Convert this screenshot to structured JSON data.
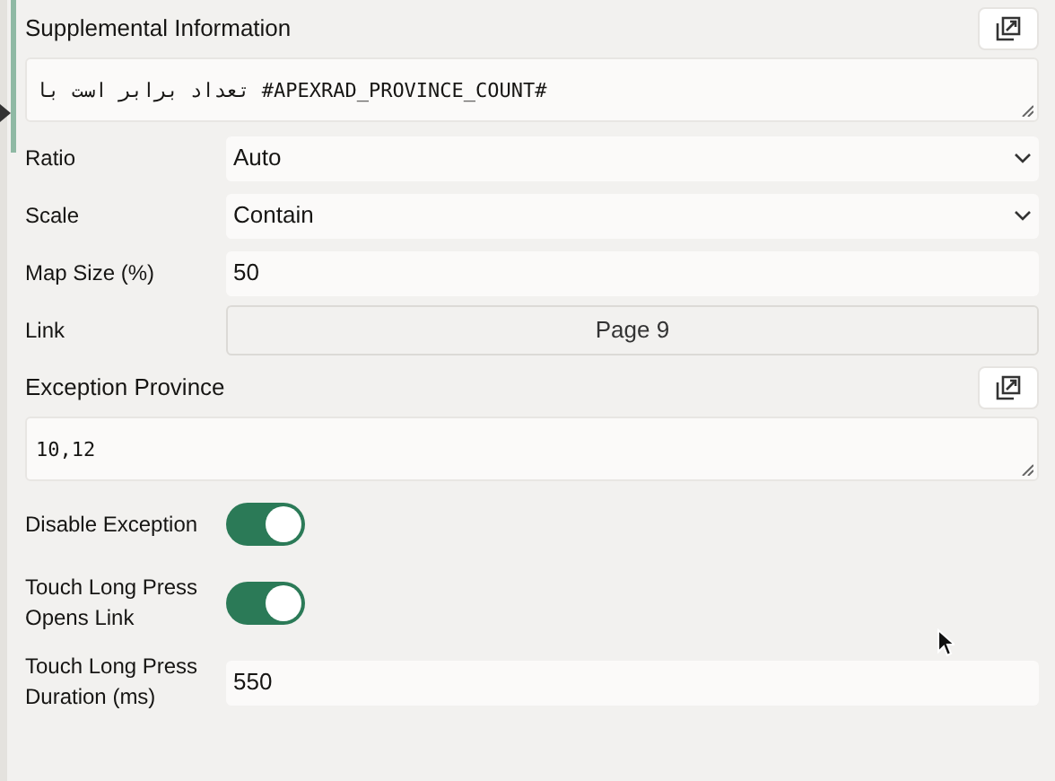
{
  "supplemental": {
    "label": "Supplemental Information",
    "value": "تعداد برابر است با #APEXRAD_PROVINCE_COUNT#"
  },
  "fields": [
    {
      "kind": "select",
      "label": "Ratio",
      "value": "Auto"
    },
    {
      "kind": "select",
      "label": "Scale",
      "value": "Contain"
    },
    {
      "kind": "text",
      "label": "Map Size (%)",
      "value": "50"
    },
    {
      "kind": "link",
      "label": "Link",
      "value": "Page 9"
    }
  ],
  "exception": {
    "label": "Exception Province",
    "value": "10,12"
  },
  "switches": [
    {
      "kind": "switch",
      "label": "Disable Exception",
      "on": true
    },
    {
      "kind": "switch",
      "label": "Touch Long Press Opens Link",
      "on": true
    },
    {
      "kind": "text",
      "label": "Touch Long Press Duration (ms)",
      "value": "550"
    }
  ]
}
